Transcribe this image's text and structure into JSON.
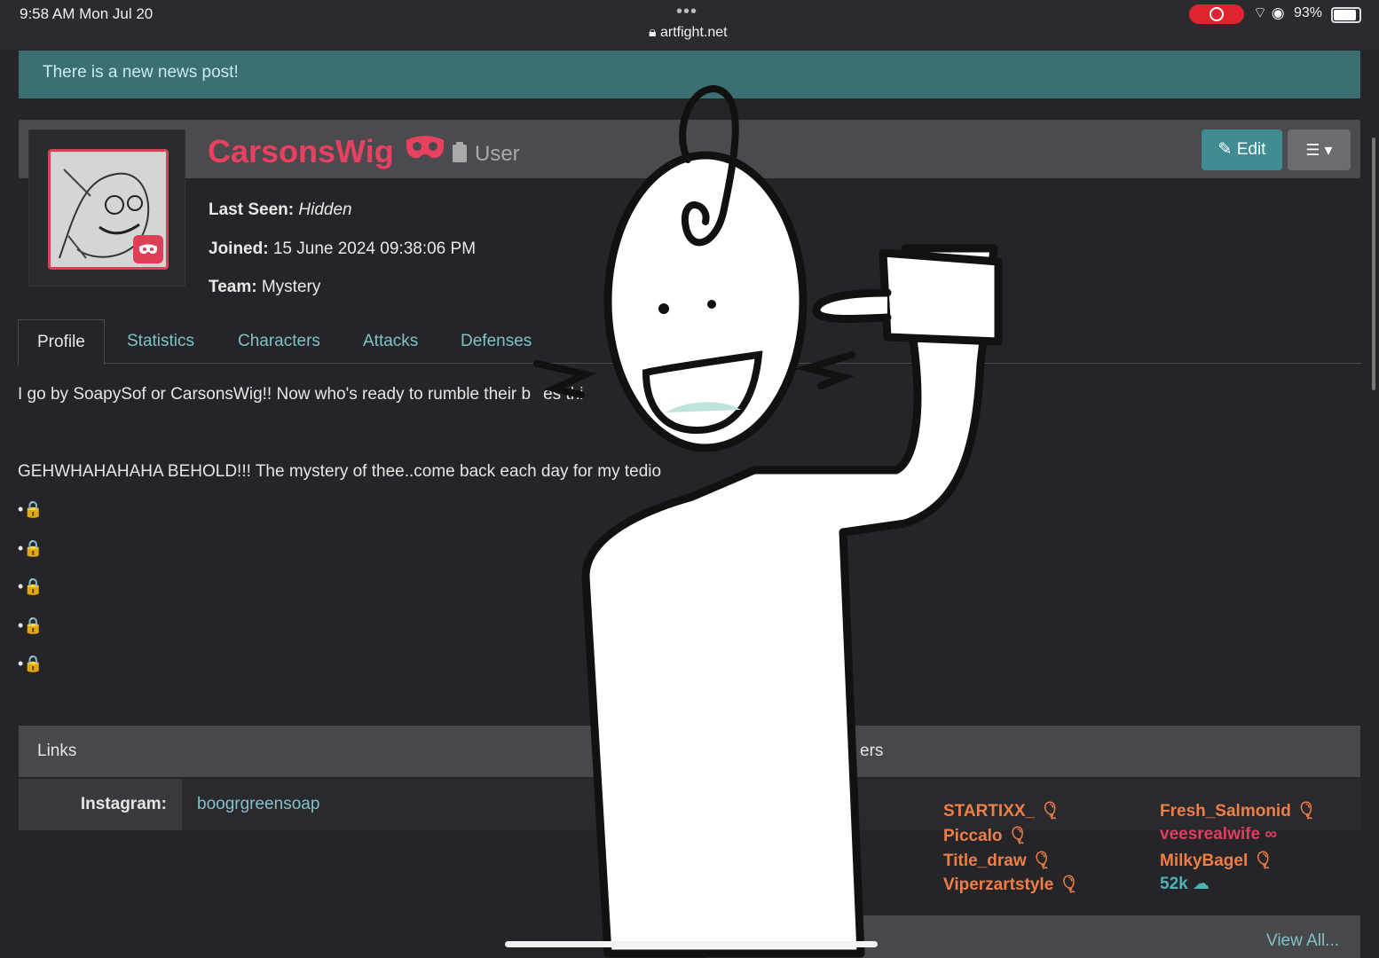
{
  "status_bar": {
    "time": "9:58 AM   Mon Jul 20",
    "dots": "•••",
    "url": "artfight.net",
    "battery": "93%"
  },
  "news": {
    "text": "There is a new news post!"
  },
  "profile": {
    "username": "CarsonsWig",
    "user_type": "User",
    "edit_label": "Edit",
    "last_seen_label": "Last Seen:",
    "last_seen_value": "Hidden",
    "joined_label": "Joined:",
    "joined_value": "15 June 2024 09:38:06 PM",
    "team_label": "Team:",
    "team_value": "Mystery"
  },
  "tabs": [
    "Profile",
    "Statistics",
    "Characters",
    "Attacks",
    "Defenses"
  ],
  "bio": {
    "line1": "I go by SoapySof or CarsonsWig!! Now who's ready to rumble their b",
    "line1_tail": "es thi",
    "line2": "GEHWHAHAHAHA BEHOLD!!! The mystery of thee..come back each day for my tedio",
    "bullet": "•🔒"
  },
  "links": {
    "heading": "Links",
    "heading_right": "ers",
    "instagram_label": "Instagram:",
    "instagram_value": "boogrgreensoap"
  },
  "friends": {
    "col1": [
      "STARTIXX_",
      "Piccalo",
      "Title_draw",
      "Viperzartstyle"
    ],
    "col2": [
      "Fresh_Salmonid",
      "veesrealwife",
      "MilkyBagel",
      "52k"
    ],
    "view_all": "View All..."
  },
  "colors": {
    "accent_red": "#e7415f",
    "accent_teal": "#3f8c93",
    "friend_orange": "#ef7f45"
  }
}
